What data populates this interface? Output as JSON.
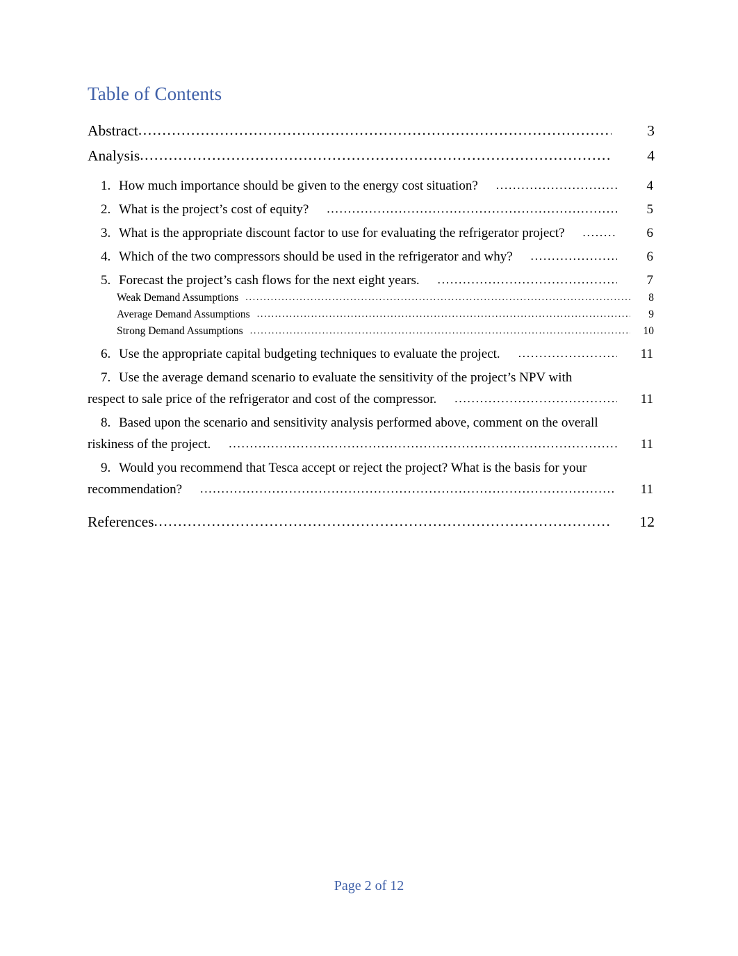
{
  "document": {
    "title": "Table of Contents",
    "title_color": "#3E5FA8",
    "leader_char": "."
  },
  "toc": {
    "level1": [
      {
        "label": "Abstract",
        "page": "3"
      },
      {
        "label": "Analysis",
        "page": "4"
      },
      {
        "label": "References",
        "page": "12"
      }
    ],
    "entries": [
      {
        "number": "1.",
        "label": "How much importance should be given to the energy cost situation?",
        "page": "4"
      },
      {
        "number": "2.",
        "label": "What is the project’s cost of equity?",
        "page": "5"
      },
      {
        "number": "3.",
        "label": "What is the appropriate discount factor to use for evaluating the refrigerator project?",
        "page": "6"
      },
      {
        "number": "4.",
        "label": "Which of the two compressors should be used in the refrigerator and why?",
        "page": "6"
      },
      {
        "number": "5.",
        "label": "Forecast the project’s cash flows for the next eight years.",
        "page": "7"
      },
      {
        "number": "6.",
        "label": "Use the appropriate capital budgeting techniques to evaluate the project.",
        "page": "11"
      },
      {
        "number": "7.",
        "label": "Use the average demand scenario to evaluate the sensitivity of the project’s NPV with",
        "label_line2": "respect to sale price of the refrigerator and cost of the compressor.",
        "page": "11"
      },
      {
        "number": "8.",
        "label": "Based upon the scenario and sensitivity analysis performed above, comment on the overall",
        "label_line2": "riskiness of the project.",
        "page": "11"
      },
      {
        "number": "9.",
        "label": "Would you recommend that Tesca accept or reject the project? What is the basis for your",
        "label_line2": "recommendation?",
        "page": "11"
      }
    ],
    "subentries": [
      {
        "label": "Weak Demand Assumptions",
        "page": "8"
      },
      {
        "label": "Average Demand Assumptions",
        "page": "9"
      },
      {
        "label": "Strong Demand Assumptions",
        "page": "10"
      }
    ]
  },
  "leaders": {
    "l1_abstract": "..................................................................................................................",
    "l1_analysis": "..................................................................................................................",
    "l1_references": "....................................................................................................",
    "e1": "......................................",
    "e2": "..........................................................................................",
    "e3": "........",
    "e4": "...........................",
    "e5": ".............................................",
    "e6": "...........................",
    "e7": "..............................................",
    "e8": "...................................................................................................",
    "e9": "..................................................................................................",
    "s1": "..................................................................................................................................",
    "s2": "...........................................................................................................................",
    "s3": "............................................................................................................................."
  },
  "footer": {
    "text": "Page 2 of 12",
    "color": "#3E5FA8"
  }
}
